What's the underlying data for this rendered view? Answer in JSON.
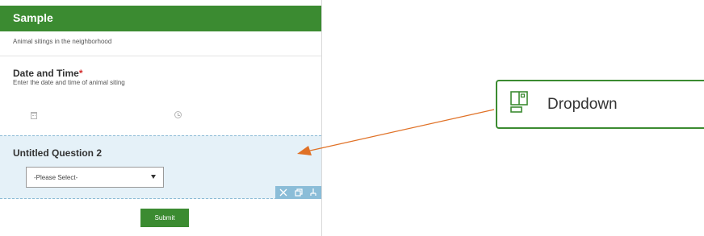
{
  "colors": {
    "brand": "#3b8b31",
    "selected_question_bg": "#e5f1f8",
    "annotation_arrow": "#e07126",
    "required_marker": "#d42d2d"
  },
  "form": {
    "title": "Sample",
    "description": "Animal sitings in the neighborhood",
    "questions": [
      {
        "title": "Date and Time",
        "required_marker": "*",
        "description": "Enter the date and time of animal siting",
        "icons": [
          "calendar-icon",
          "clock-icon"
        ]
      },
      {
        "title": "Untitled Question 2",
        "select_value": "-Please Select-",
        "toolbar_icons": [
          "delete-icon",
          "copy-icon",
          "move-icon"
        ]
      }
    ],
    "submit_label": "Submit"
  },
  "callout": {
    "icon": "dropdown-icon",
    "label": "Dropdown"
  }
}
